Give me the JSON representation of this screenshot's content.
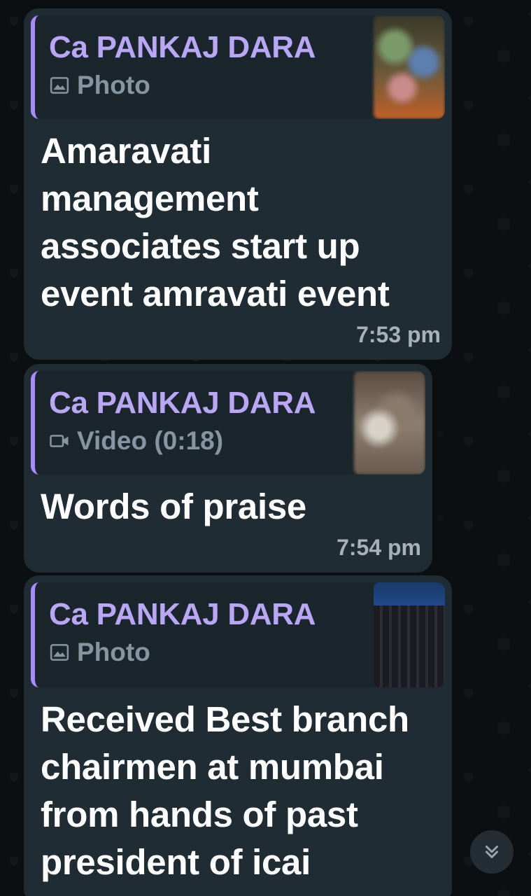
{
  "messages": [
    {
      "quote_author": "Ca PANKAJ DARA",
      "quote_media": "Photo",
      "quote_media_icon": "image-icon",
      "text": "Amaravati management associates start up event amravati event",
      "time": "7:53 pm"
    },
    {
      "quote_author": "Ca PANKAJ DARA",
      "quote_media": "Video (0:18)",
      "quote_media_icon": "video-camera-icon",
      "text": "Words of praise",
      "time": "7:54 pm"
    },
    {
      "quote_author": "Ca PANKAJ DARA",
      "quote_media": "Photo",
      "quote_media_icon": "image-icon",
      "text": "Received Best branch chairmen at mumbai from hands of past president of icai",
      "time": ""
    }
  ],
  "colors": {
    "bubble": "#1f2c34",
    "quote_bar": "#a78bfa",
    "quote_author": "#b9a6f5"
  },
  "scroll_button_icon": "double-chevron-down-icon"
}
